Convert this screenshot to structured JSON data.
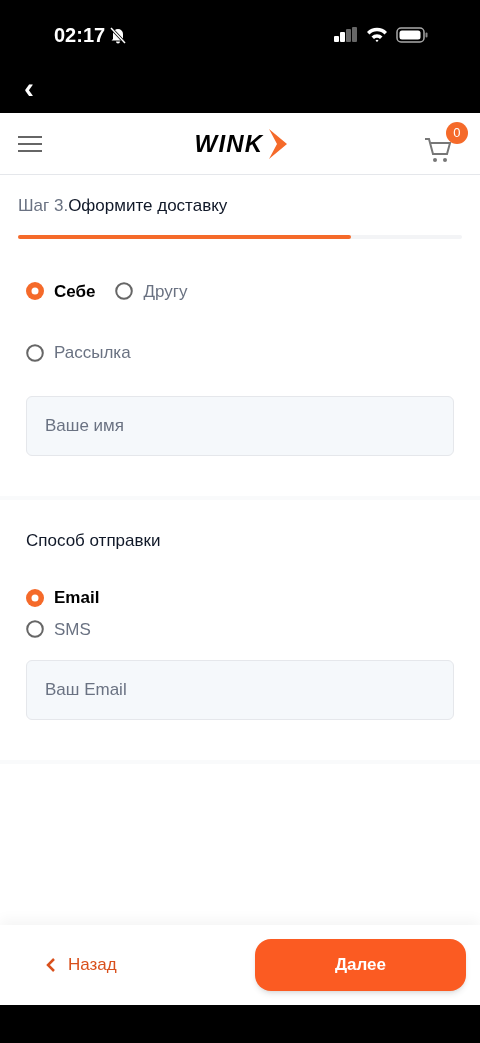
{
  "status_bar": {
    "time": "02:17",
    "silent": true
  },
  "nav": {
    "back": "‹"
  },
  "header": {
    "logo": "WINK",
    "cart_count": "0"
  },
  "step": {
    "prefix": "Шаг 3.",
    "title": "Оформите доставку",
    "level": 0.75
  },
  "recipient": [
    {
      "label": "Себе",
      "selected": true
    },
    {
      "label": "Другу",
      "selected": false
    },
    {
      "label": "Рассылка",
      "selected": false
    }
  ],
  "name_field": {
    "placeholder": "Ваше имя"
  },
  "delivery": {
    "title": "Способ отправки",
    "options": [
      {
        "label": "Email",
        "selected": true
      },
      {
        "label": "SMS",
        "selected": false
      }
    ]
  },
  "email_field": {
    "placeholder": "Ваш Email"
  },
  "footer": {
    "back": "Назад",
    "next": "Далее"
  }
}
